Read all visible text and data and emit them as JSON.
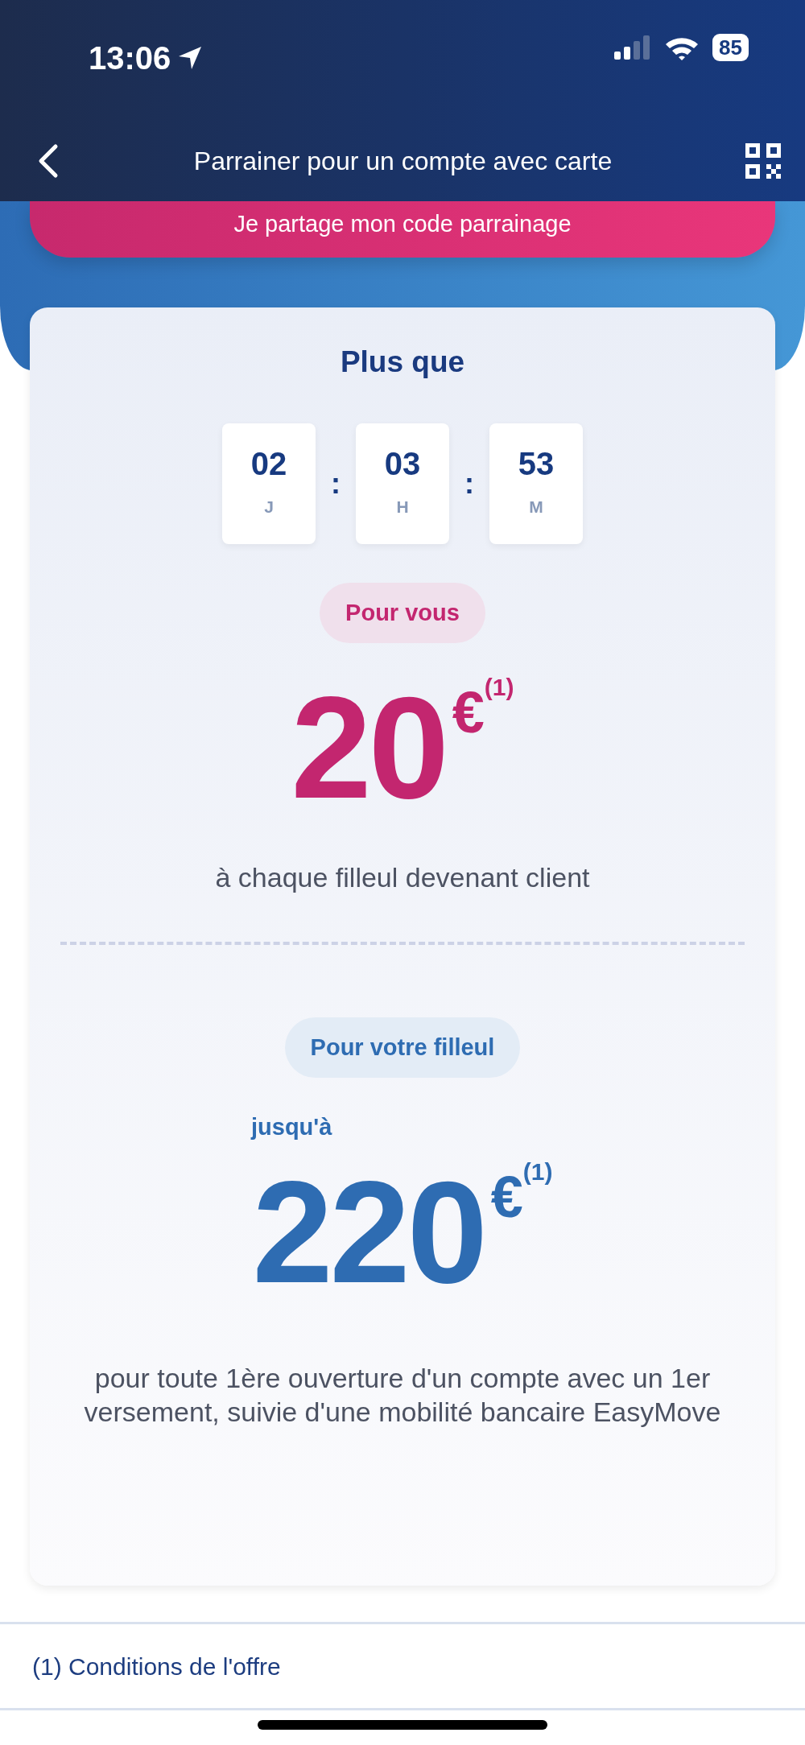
{
  "status_bar": {
    "time": "13:06",
    "battery": "85"
  },
  "header": {
    "title": "Parrainer pour un compte avec carte"
  },
  "share_button": {
    "label": "Je partage mon code parrainage"
  },
  "countdown": {
    "title": "Plus que",
    "separators": [
      ":",
      ":"
    ],
    "units": [
      {
        "value": "02",
        "unit": "J"
      },
      {
        "value": "03",
        "unit": "H"
      },
      {
        "value": "53",
        "unit": "M"
      }
    ]
  },
  "sections": [
    {
      "kind": "you",
      "tag": "Pour vous",
      "amount": "20",
      "currency": "€",
      "note": "(1)",
      "description": "à chaque filleul devenant client"
    },
    {
      "kind": "friend",
      "tag": "Pour votre filleul",
      "prefix": "jusqu'à",
      "amount": "220",
      "currency": "€",
      "note": "(1)",
      "description": "pour toute 1ère ouverture d'un compte avec un 1er versement, suivie d'une mobilité bancaire EasyMove"
    }
  ],
  "footer": {
    "link": "(1) Conditions de l'offre"
  }
}
